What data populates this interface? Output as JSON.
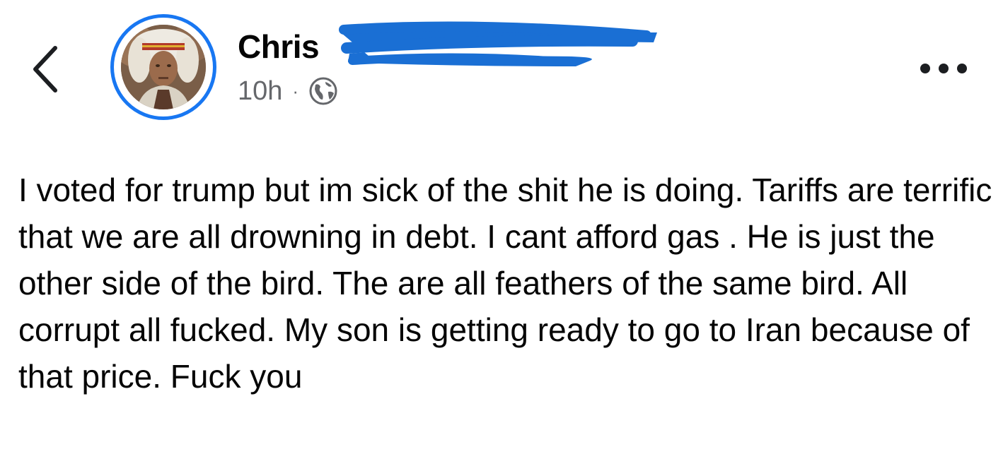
{
  "post": {
    "author_name": "Chris",
    "timestamp": "10h",
    "separator": "·",
    "privacy_icon": "globe-icon",
    "body": "I voted for trump but im sick of the shit he is doing. Tariffs are terrific that we are all drowning in debt. I cant afford gas . He is just the other side of the bird. The are all feathers of the same bird. All corrupt all fucked. My son is getting ready to go to Iran because of that price. Fuck you"
  },
  "header": {
    "back_icon": "chevron-left-icon",
    "more_icon": "more-options-icon"
  },
  "colors": {
    "accent": "#1877f2",
    "redaction": "#1a6fd4",
    "secondary_text": "#65676b",
    "primary_text": "#050505"
  }
}
